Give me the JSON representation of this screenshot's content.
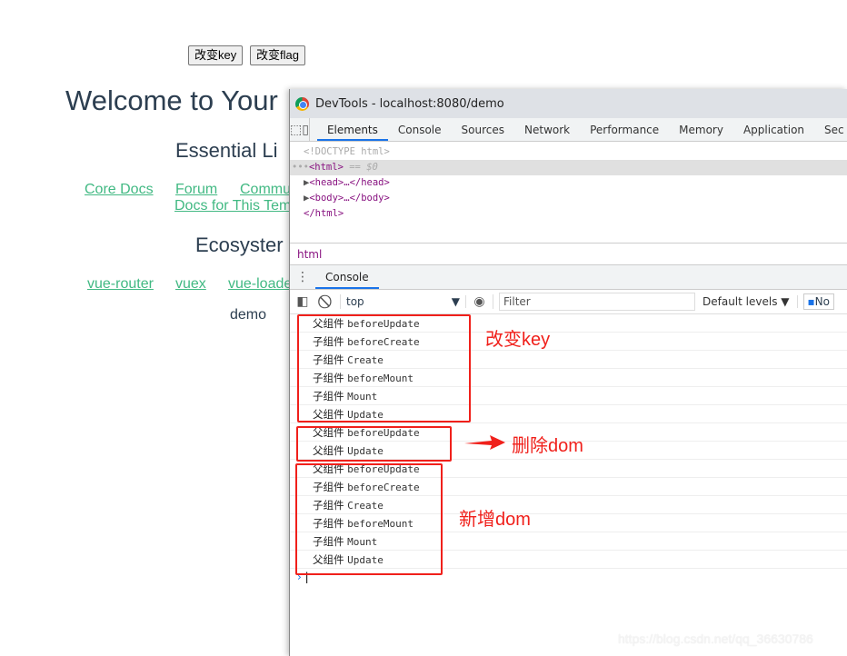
{
  "page": {
    "buttons": [
      "改变key",
      "改变flag"
    ],
    "title": "Welcome to Your",
    "essential_heading": "Essential Li",
    "essential_links": [
      "Core Docs",
      "Forum",
      "Commu",
      "Docs for This Tem"
    ],
    "ecosystem_heading": "Ecosyster",
    "ecosystem_links": [
      "vue-router",
      "vuex",
      "vue-loade"
    ],
    "demo": "demo"
  },
  "devtools": {
    "title": "DevTools - localhost:8080/demo",
    "tabs": [
      "Elements",
      "Console",
      "Sources",
      "Network",
      "Performance",
      "Memory",
      "Application",
      "Sec"
    ],
    "active_tab": "Elements",
    "elements": {
      "doctype": "<!DOCTYPE html>",
      "html": "<html>",
      "selected_marker": "== $0",
      "head": "<head>…</head>",
      "body": "<body>…</body>",
      "close": "</html>"
    },
    "breadcrumb": "html",
    "drawer_tab": "Console",
    "console": {
      "context": "top",
      "filter_placeholder": "Filter",
      "levels": "Default levels ▼",
      "issues": "No",
      "logs": [
        [
          "父组件",
          "beforeUpdate"
        ],
        [
          "子组件",
          "beforeCreate"
        ],
        [
          "子组件",
          "Create"
        ],
        [
          "子组件",
          "beforeMount"
        ],
        [
          "子组件",
          "Mount"
        ],
        [
          "父组件",
          "Update"
        ],
        [
          "父组件",
          "beforeUpdate"
        ],
        [
          "父组件",
          "Update"
        ],
        [
          "父组件",
          "beforeUpdate"
        ],
        [
          "子组件",
          "beforeCreate"
        ],
        [
          "子组件",
          "Create"
        ],
        [
          "子组件",
          "beforeMount"
        ],
        [
          "子组件",
          "Mount"
        ],
        [
          "父组件",
          "Update"
        ]
      ]
    }
  },
  "annotations": {
    "a1": "改变key",
    "a2": "删除dom",
    "a3": "新增dom",
    "color": "#f0201b"
  },
  "watermark": "https://blog.csdn.net/qq_36630786"
}
